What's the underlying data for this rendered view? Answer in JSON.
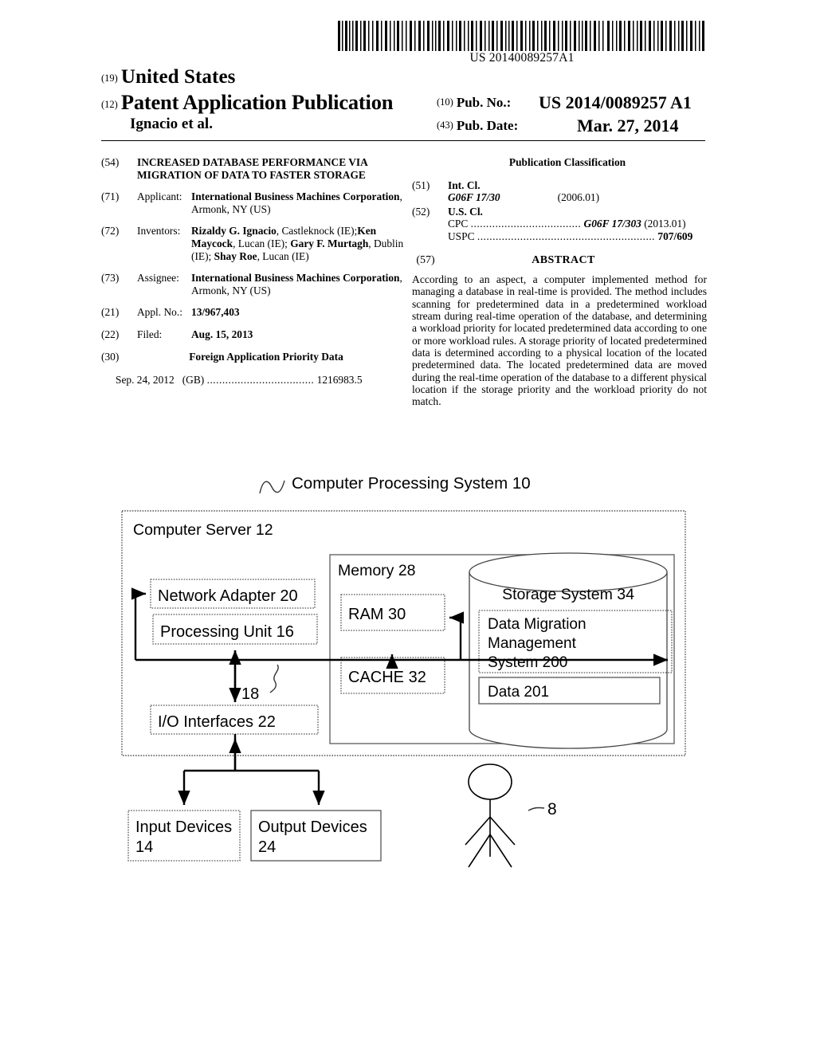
{
  "header": {
    "barcode_number": "US 20140089257A1",
    "inid_19": "(19)",
    "country": "United States",
    "inid_12": "(12)",
    "doc_type": "Patent Application Publication",
    "authors": "Ignacio et al.",
    "inid_10": "(10)",
    "pubno_label": "Pub. No.:",
    "pubno_value": "US 2014/0089257 A1",
    "inid_43": "(43)",
    "pubdate_label": "Pub. Date:",
    "pubdate_value": "Mar. 27, 2014"
  },
  "left": {
    "title": {
      "inid": "(54)",
      "text": "INCREASED DATABASE PERFORMANCE VIA MIGRATION OF DATA TO FASTER STORAGE"
    },
    "applicant": {
      "inid": "(71)",
      "label": "Applicant:",
      "name": "International Business Machines Corporation",
      "rest": ", Armonk, NY (US)"
    },
    "inventors": {
      "inid": "(72)",
      "label": "Inventors:",
      "list": [
        {
          "name": "Rizaldy G. Ignacio",
          "place": ", Castleknock (IE);"
        },
        {
          "name": "Ken Maycock",
          "place": ", Lucan (IE); "
        },
        {
          "name": "Gary F. Murtagh",
          "place": ", Dublin (IE); "
        },
        {
          "name": "Shay Roe",
          "place": ", Lucan (IE)"
        }
      ]
    },
    "assignee": {
      "inid": "(73)",
      "label": "Assignee:",
      "name": "International Business Machines Corporation",
      "rest": ", Armonk, NY (US)"
    },
    "appl_no": {
      "inid": "(21)",
      "label": "Appl. No.:",
      "value": "13/967,403"
    },
    "filed": {
      "inid": "(22)",
      "label": "Filed:",
      "value": "Aug. 15, 2013"
    },
    "foreign": {
      "inid": "(30)",
      "heading": "Foreign Application Priority Data",
      "date": "Sep. 24, 2012",
      "country": "(GB)",
      "dots": "...................................",
      "number": "1216983.5"
    }
  },
  "right": {
    "pub_classification_heading": "Publication Classification",
    "int_cl": {
      "inid": "(51)",
      "label": "Int. Cl.",
      "code": "G06F 17/30",
      "edition": "(2006.01)"
    },
    "us_cl": {
      "inid": "(52)",
      "label": "U.S. Cl.",
      "cpc_label": "CPC",
      "cpc_dots": "....................................",
      "cpc_code": "G06F 17/303",
      "cpc_edition": "(2013.01)",
      "uspc_label": "USPC",
      "uspc_dots": "..........................................................",
      "uspc_code": "707/609"
    },
    "abstract": {
      "inid": "(57)",
      "heading": "ABSTRACT",
      "text": "According to an aspect, a computer implemented method for managing a database in real-time is provided. The method includes scanning for predetermined data in a predetermined workload stream during real-time operation of the database, and determining a workload priority for located predetermined data according to one or more workload rules. A storage priority of located predetermined data is determined according to a physical location of the located predetermined data. The located predetermined data are moved during the real-time operation of the database to a different physical location if the storage priority and the workload priority do not match."
    }
  },
  "figure": {
    "caption": "Computer Processing System 10",
    "server_label": "Computer Server 12",
    "network_adapter": "Network Adapter 20",
    "processing_unit": "Processing Unit 16",
    "io_interfaces": "I/O Interfaces 22",
    "bus_label": "18",
    "memory_label": "Memory 28",
    "ram": "RAM 30",
    "cache": "CACHE 32",
    "storage_system": "Storage System 34",
    "dmms": "Data Migration Management System 200",
    "dmms_line1": "Data Migration",
    "dmms_line2": "Management",
    "dmms_line3": "System 200",
    "data": "Data 201",
    "input_devices_line1": "Input Devices",
    "input_devices_line2": "14",
    "output_devices_line1": "Output Devices",
    "output_devices_line2": "24",
    "user_label": "8"
  }
}
